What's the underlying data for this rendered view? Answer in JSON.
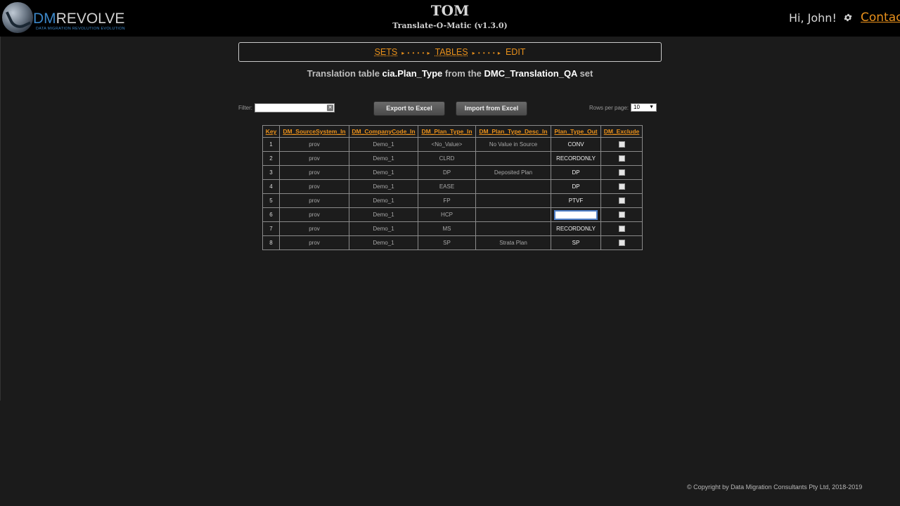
{
  "brand": {
    "logo_dm": "DM",
    "logo_rest": "REVOLVE",
    "tagline": "DATA MIGRATION REVOLUTION EVOLUTION",
    "title": "TOM",
    "subtitle": "Translate-O-Matic (v1.3.0)"
  },
  "user": {
    "greeting": "Hi, John!",
    "contact": "Contact",
    "icon": "gear-icon"
  },
  "breadcrumb": {
    "sets": "SETS",
    "tables": "TABLES",
    "edit": "EDIT",
    "arrow": "▸ • • • • ▸"
  },
  "heading": {
    "prefix": "Translation table ",
    "table": "cia.Plan_Type",
    "mid": " from the ",
    "set": "DMC_Translation_QA",
    "suffix": " set"
  },
  "toolbar": {
    "filter_label": "Filter:",
    "filter_value": "",
    "export_label": "Export to Excel",
    "import_label": "Import from Excel",
    "rows_label": "Rows per page:",
    "rows_value": "10"
  },
  "table": {
    "columns": [
      "Key",
      "DM_SourceSystem_In",
      "DM_CompanyCode_In",
      "DM_Plan_Type_In",
      "DM_Plan_Type_Desc_In",
      "Plan_Type_Out",
      "DM_Exclude"
    ],
    "rows": [
      {
        "key": "1",
        "source": "prov",
        "company": "Demo_1",
        "plan_in": "<No_Value>",
        "desc": "No Value in Source",
        "out": "CONV",
        "exclude": false
      },
      {
        "key": "2",
        "source": "prov",
        "company": "Demo_1",
        "plan_in": "CLRD",
        "desc": "",
        "out": "RECORDONLY",
        "exclude": false
      },
      {
        "key": "3",
        "source": "prov",
        "company": "Demo_1",
        "plan_in": "DP",
        "desc": "Deposited Plan",
        "out": "DP",
        "exclude": false
      },
      {
        "key": "4",
        "source": "prov",
        "company": "Demo_1",
        "plan_in": "EASE",
        "desc": "",
        "out": "DP",
        "exclude": false
      },
      {
        "key": "5",
        "source": "prov",
        "company": "Demo_1",
        "plan_in": "FP",
        "desc": "",
        "out": "PTVF",
        "exclude": false
      },
      {
        "key": "6",
        "source": "prov",
        "company": "Demo_1",
        "plan_in": "HCP",
        "desc": "",
        "out": "",
        "exclude": false
      },
      {
        "key": "7",
        "source": "prov",
        "company": "Demo_1",
        "plan_in": "MS",
        "desc": "",
        "out": "RECORDONLY",
        "exclude": false
      },
      {
        "key": "8",
        "source": "prov",
        "company": "Demo_1",
        "plan_in": "SP",
        "desc": "Strata Plan",
        "out": "SP",
        "exclude": false
      }
    ]
  },
  "footer": {
    "copyright": "© Copyright by Data Migration Consultants Pty Ltd, 2018-2019"
  }
}
